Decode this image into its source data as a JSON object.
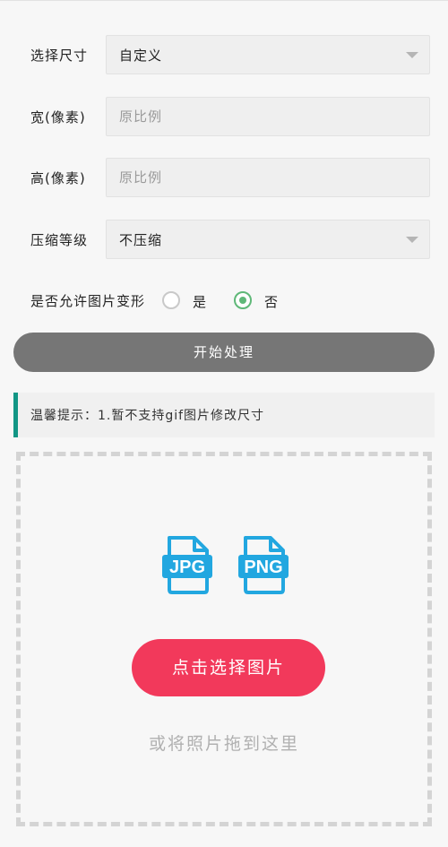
{
  "form": {
    "size": {
      "label": "选择尺寸",
      "value": "自定义"
    },
    "width": {
      "label": "宽(像素)",
      "placeholder": "原比例"
    },
    "height": {
      "label": "高(像素)",
      "placeholder": "原比例"
    },
    "compression": {
      "label": "压缩等级",
      "value": "不压缩"
    },
    "deform": {
      "label": "是否允许图片变形",
      "options": [
        {
          "label": "是",
          "checked": false
        },
        {
          "label": "否",
          "checked": true
        }
      ]
    }
  },
  "start_button": "开始处理",
  "tip": "温馨提示：1.暂不支持gif图片修改尺寸",
  "upload": {
    "icons": [
      {
        "name": "jpg-file-icon",
        "text": "JPG"
      },
      {
        "name": "png-file-icon",
        "text": "PNG"
      }
    ],
    "choose_button": "点击选择图片",
    "drag_hint": "或将照片拖到这里"
  },
  "colors": {
    "accent_green": "#5fb878",
    "tip_bar": "#129685",
    "primary_red": "#f2395b",
    "icon_blue": "#22a7e0"
  }
}
